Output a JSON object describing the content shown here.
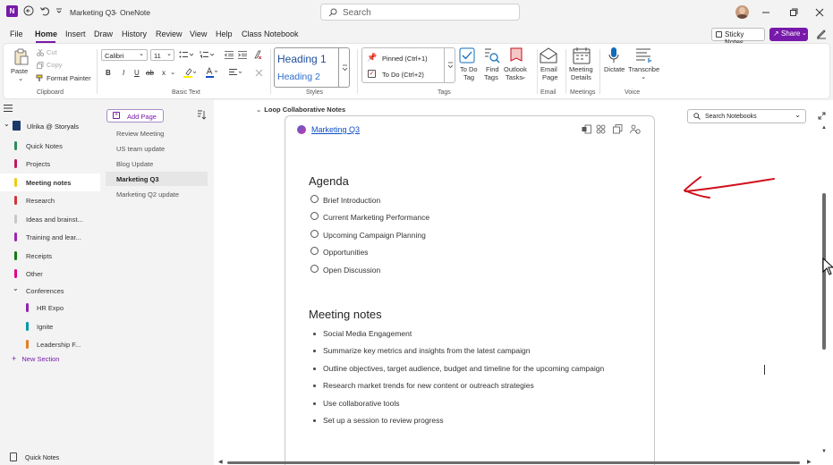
{
  "titlebar": {
    "doc_title": "Marketing Q3",
    "separator": "-",
    "app_name": "OneNote",
    "search_placeholder": "Search"
  },
  "menu": {
    "items": [
      "File",
      "Home",
      "Insert",
      "Draw",
      "History",
      "Review",
      "View",
      "Help",
      "Class Notebook"
    ],
    "active": "Home",
    "sticky_notes": "Sticky Notes",
    "share": "Share"
  },
  "ribbon": {
    "clipboard": {
      "paste": "Paste",
      "cut": "Cut",
      "copy": "Copy",
      "format_painter": "Format Painter",
      "group": "Clipboard"
    },
    "basic_text": {
      "font": "Calibri",
      "size": "11",
      "bold": "B",
      "italic": "I",
      "underline": "U",
      "strike": "ab",
      "sub": "x",
      "group": "Basic Text"
    },
    "styles": {
      "heading1": "Heading 1",
      "heading2": "Heading 2",
      "group": "Styles"
    },
    "tags": {
      "pinned": "Pinned (Ctrl+1)",
      "todo": "To Do (Ctrl+2)",
      "todo_tag_1": "To Do",
      "todo_tag_2": "Tag",
      "find_tags_1": "Find",
      "find_tags_2": "Tags",
      "outlook_1": "Outlook",
      "outlook_2": "Tasks",
      "group": "Tags"
    },
    "email": {
      "label_1": "Email",
      "label_2": "Page",
      "group": "Email"
    },
    "meetings": {
      "label_1": "Meeting",
      "label_2": "Details",
      "group": "Meetings"
    },
    "voice": {
      "dictate": "Dictate",
      "transcribe": "Transcribe",
      "group": "Voice"
    }
  },
  "nav": {
    "notebook": "Ulrika @ Storyals",
    "sections": [
      {
        "label": "Quick Notes",
        "color": "#2e8b57"
      },
      {
        "label": "Projects",
        "color": "#c2185b"
      },
      {
        "label": "Meeting notes",
        "color": "#f2c811"
      },
      {
        "label": "Research",
        "color": "#d13438"
      },
      {
        "label": "Ideas and brainst...",
        "color": "#c8c8c8"
      },
      {
        "label": "Training and lear...",
        "color": "#9c27b0"
      },
      {
        "label": "Receipts",
        "color": "#107c10"
      },
      {
        "label": "Other",
        "color": "#e3008c"
      }
    ],
    "group": "Conferences",
    "subsections": [
      {
        "label": "HR Expo",
        "color": "#8e24aa"
      },
      {
        "label": "Ignite",
        "color": "#0097a7"
      },
      {
        "label": "Leadership F...",
        "color": "#e67e22"
      }
    ],
    "new_section": "New Section",
    "quick_notes_footer": "Quick Notes"
  },
  "pages": {
    "add_page": "Add Page",
    "items": [
      "Review Meeting",
      "US team update",
      "Blog Update",
      "Marketing Q3",
      "Marketing Q2 update"
    ],
    "selected": "Marketing Q3"
  },
  "canvas": {
    "loop_header": "Loop Collaborative Notes",
    "loop_title": "Marketing Q3",
    "search_notebooks": "Search Notebooks",
    "agenda_title": "Agenda",
    "agenda": [
      "Brief Introduction",
      "Current Marketing Performance",
      "Upcoming Campaign Planning",
      "Opportunities",
      "Open Discussion"
    ],
    "notes_title": "Meeting notes",
    "notes": [
      "Social Media Engagement",
      "Summarize key metrics and insights from the latest campaign",
      "Outline objectives, target audience, budget and timeline for the upcoming campaign",
      "Research market trends for new content or outreach strategies",
      "Use collaborative tools",
      "Set up a session to review progress"
    ]
  },
  "colors": {
    "accent": "#7719aa",
    "link": "#0f4fc2",
    "annotation": "#d0101c"
  }
}
